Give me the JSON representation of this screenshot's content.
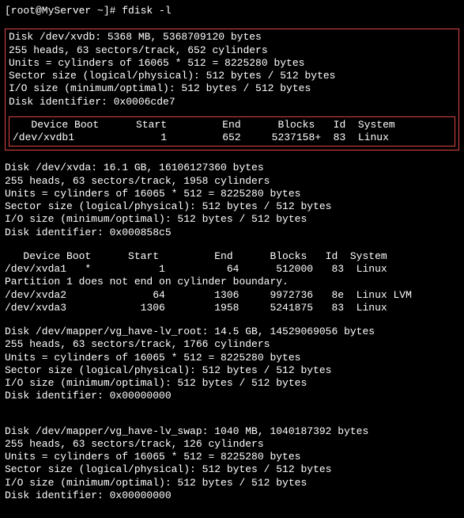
{
  "prompt": "[root@MyServer ~]# fdisk -l",
  "disk1": {
    "header": "Disk /dev/xvdb: 5368 MB, 5368709120 bytes",
    "geom": "255 heads, 63 sectors/track, 652 cylinders",
    "units": "Units = cylinders of 16065 * 512 = 8225280 bytes",
    "sector": "Sector size (logical/physical): 512 bytes / 512 bytes",
    "io": "I/O size (minimum/optimal): 512 bytes / 512 bytes",
    "id": "Disk identifier: 0x0006cde7",
    "table_head": "   Device Boot      Start         End      Blocks   Id  System",
    "row1": "/dev/xvdb1              1         652     5237158+  83  Linux"
  },
  "disk2": {
    "header": "Disk /dev/xvda: 16.1 GB, 16106127360 bytes",
    "geom": "255 heads, 63 sectors/track, 1958 cylinders",
    "units": "Units = cylinders of 16065 * 512 = 8225280 bytes",
    "sector": "Sector size (logical/physical): 512 bytes / 512 bytes",
    "io": "I/O size (minimum/optimal): 512 bytes / 512 bytes",
    "id": "Disk identifier: 0x000858c5",
    "table_head": "   Device Boot      Start         End      Blocks   Id  System",
    "row1": "/dev/xvda1   *           1          64      512000   83  Linux",
    "warn": "Partition 1 does not end on cylinder boundary.",
    "row2": "/dev/xvda2              64        1306     9972736   8e  Linux LVM",
    "row3": "/dev/xvda3            1306        1958     5241875   83  Linux"
  },
  "disk3": {
    "header": "Disk /dev/mapper/vg_have-lv_root: 14.5 GB, 14529069056 bytes",
    "geom": "255 heads, 63 sectors/track, 1766 cylinders",
    "units": "Units = cylinders of 16065 * 512 = 8225280 bytes",
    "sector": "Sector size (logical/physical): 512 bytes / 512 bytes",
    "io": "I/O size (minimum/optimal): 512 bytes / 512 bytes",
    "id": "Disk identifier: 0x00000000"
  },
  "disk4": {
    "header": "Disk /dev/mapper/vg_have-lv_swap: 1040 MB, 1040187392 bytes",
    "geom": "255 heads, 63 sectors/track, 126 cylinders",
    "units": "Units = cylinders of 16065 * 512 = 8225280 bytes",
    "sector": "Sector size (logical/physical): 512 bytes / 512 bytes",
    "io": "I/O size (minimum/optimal): 512 bytes / 512 bytes",
    "id": "Disk identifier: 0x00000000"
  }
}
